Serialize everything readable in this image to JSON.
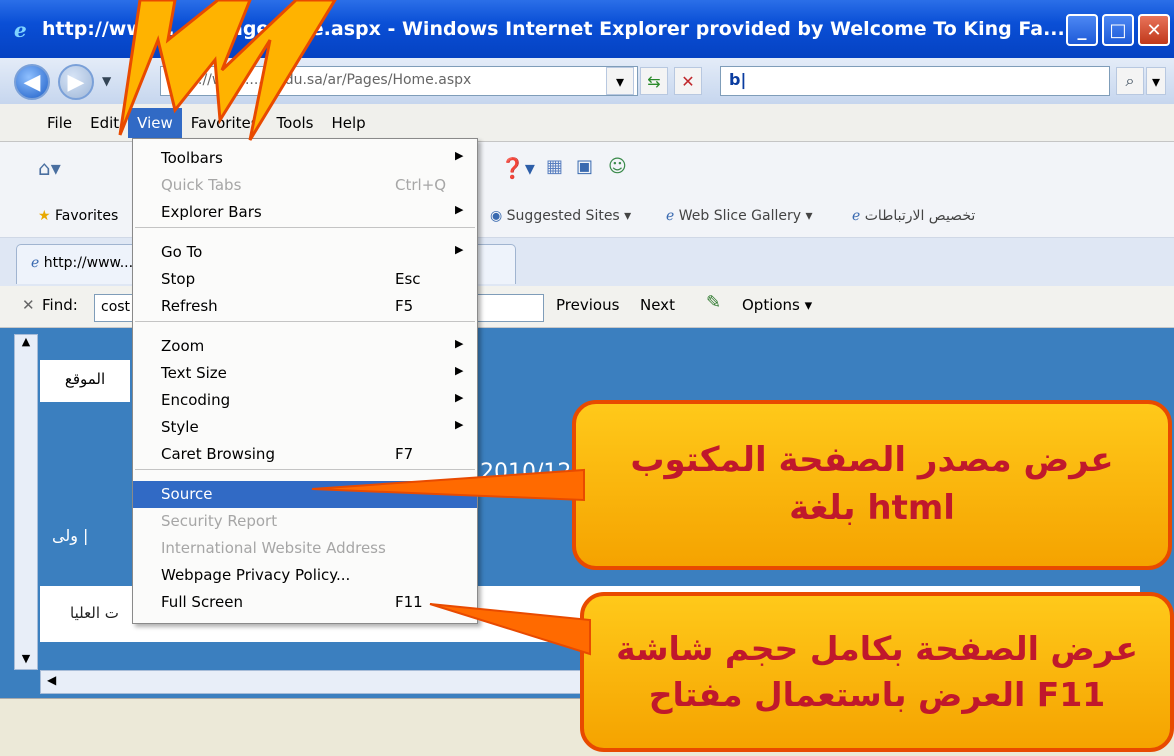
{
  "window": {
    "title": "http://www...ed...age...me.aspx - Windows Internet Explorer provided by Welcome To King Fa...",
    "url": "http://www....u.edu.sa/ar/Pages/Home.aspx",
    "search_value": "b|"
  },
  "menubar": {
    "items": [
      "File",
      "Edit",
      "View",
      "Favorites",
      "Tools",
      "Help"
    ]
  },
  "command_bar": {
    "favorites": "Favorites",
    "suggested_sites": "Suggested Sites ▾",
    "web_slice_gallery": "Web Slice Gallery ▾",
    "customize_links": "تخصيص الارتباطات"
  },
  "tab": {
    "label": "http://www..."
  },
  "findbar": {
    "close": "✕",
    "label": "Find:",
    "value": "cost",
    "previous": "Previous",
    "next": "Next",
    "options": "Options ▾"
  },
  "page": {
    "site_label": "الموقع",
    "date_text": "2010/12",
    "nav_text": "ت العليا",
    "side_text": "ولى |"
  },
  "view_menu": {
    "items": [
      {
        "label": "Toolbars",
        "shortcut": "",
        "submenu": true,
        "disabled": false
      },
      {
        "label": "Quick Tabs",
        "shortcut": "Ctrl+Q",
        "submenu": false,
        "disabled": true
      },
      {
        "label": "Explorer Bars",
        "shortcut": "",
        "submenu": true,
        "disabled": false
      },
      {
        "label": "Go To",
        "shortcut": "",
        "submenu": true,
        "disabled": false
      },
      {
        "label": "Stop",
        "shortcut": "Esc",
        "submenu": false,
        "disabled": false
      },
      {
        "label": "Refresh",
        "shortcut": "F5",
        "submenu": false,
        "disabled": false
      },
      {
        "label": "Zoom",
        "shortcut": "",
        "submenu": true,
        "disabled": false
      },
      {
        "label": "Text Size",
        "shortcut": "",
        "submenu": true,
        "disabled": false
      },
      {
        "label": "Encoding",
        "shortcut": "",
        "submenu": true,
        "disabled": false
      },
      {
        "label": "Style",
        "shortcut": "",
        "submenu": true,
        "disabled": false
      },
      {
        "label": "Caret Browsing",
        "shortcut": "F7",
        "submenu": false,
        "disabled": false
      },
      {
        "label": "Source",
        "shortcut": "",
        "submenu": false,
        "disabled": false,
        "selected": true
      },
      {
        "label": "Security Report",
        "shortcut": "",
        "submenu": false,
        "disabled": true
      },
      {
        "label": "International Website Address",
        "shortcut": "",
        "submenu": false,
        "disabled": true
      },
      {
        "label": "Webpage Privacy Policy...",
        "shortcut": "",
        "submenu": false,
        "disabled": false
      },
      {
        "label": "Full Screen",
        "shortcut": "F11",
        "submenu": false,
        "disabled": false
      }
    ]
  },
  "callouts": {
    "source_line1": "عرض مصدر الصفحة المكتوب",
    "source_line2": "بلغة html",
    "fullscreen_line1": "عرض الصفحة بكامل حجم شاشة",
    "fullscreen_line2": "العرض باستعمال مفتاح F11"
  },
  "colors": {
    "titlebar": "#0a4fd6",
    "menu_selection": "#316ac5",
    "callout_fill": "#f5a300",
    "callout_border": "#e84a00",
    "callout_text": "#c0182c"
  }
}
